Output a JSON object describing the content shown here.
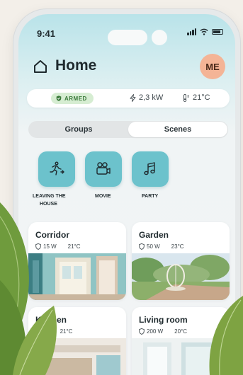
{
  "status_bar": {
    "time": "9:41"
  },
  "header": {
    "title": "Home",
    "avatar_initials": "ME"
  },
  "system": {
    "security_state": "ARMED",
    "power": "2,3 kW",
    "temperature": "21°C"
  },
  "tabs": [
    {
      "label": "Groups",
      "active": true
    },
    {
      "label": "Scenes",
      "active": false
    }
  ],
  "groups": [
    {
      "label_line1": "LEAVING THE",
      "label_line2": "HOUSE",
      "icon": "running-person-icon"
    },
    {
      "label_line1": "MOVIE",
      "label_line2": "",
      "icon": "movie-camera-icon"
    },
    {
      "label_line1": "PARTY",
      "label_line2": "",
      "icon": "music-note-icon"
    }
  ],
  "rooms": [
    {
      "name": "Corridor",
      "power": "15 W",
      "temperature": "21°C"
    },
    {
      "name": "Garden",
      "power": "50 W",
      "temperature": "23°C"
    },
    {
      "name": "Kitchen",
      "power": "W",
      "temperature": "21°C"
    },
    {
      "name": "Living room",
      "power": "200 W",
      "temperature": "20°C"
    }
  ],
  "colors": {
    "accent": "#6cc2cc",
    "avatar": "#f4b496",
    "armed_bg": "#d6edd2",
    "armed_text": "#3b7a3b"
  }
}
